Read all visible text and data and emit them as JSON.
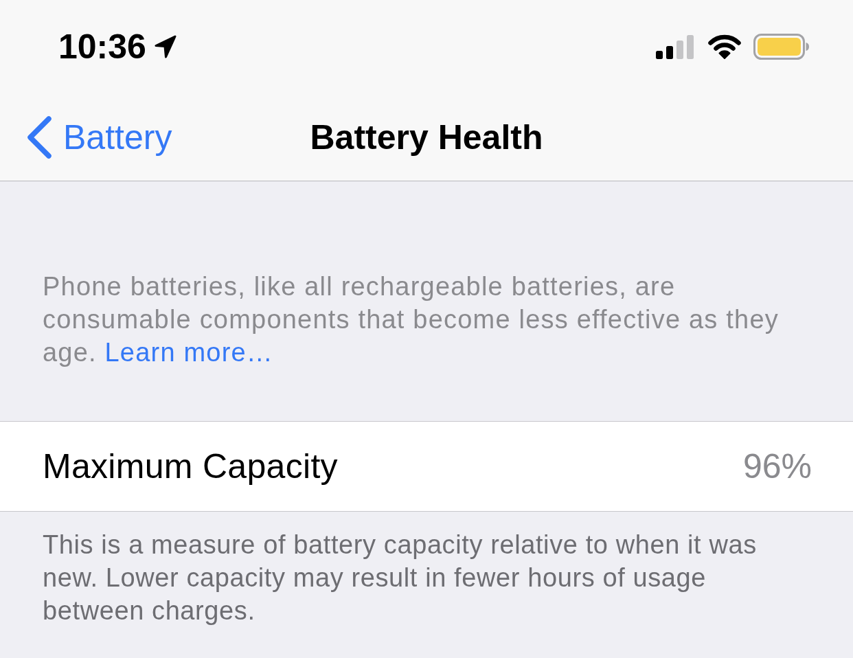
{
  "status_bar": {
    "time": "10:36"
  },
  "nav_bar": {
    "back_label": "Battery",
    "title": "Battery Health"
  },
  "intro": {
    "text": "Phone batteries, like all rechargeable batteries, are consumable components that become less effective as they age.",
    "link": "Learn more…"
  },
  "rows": [
    {
      "label": "Maximum Capacity",
      "value": "96%"
    }
  ],
  "footer": "This is a measure of battery capacity relative to when it was new. Lower capacity may result in fewer hours of usage between charges."
}
